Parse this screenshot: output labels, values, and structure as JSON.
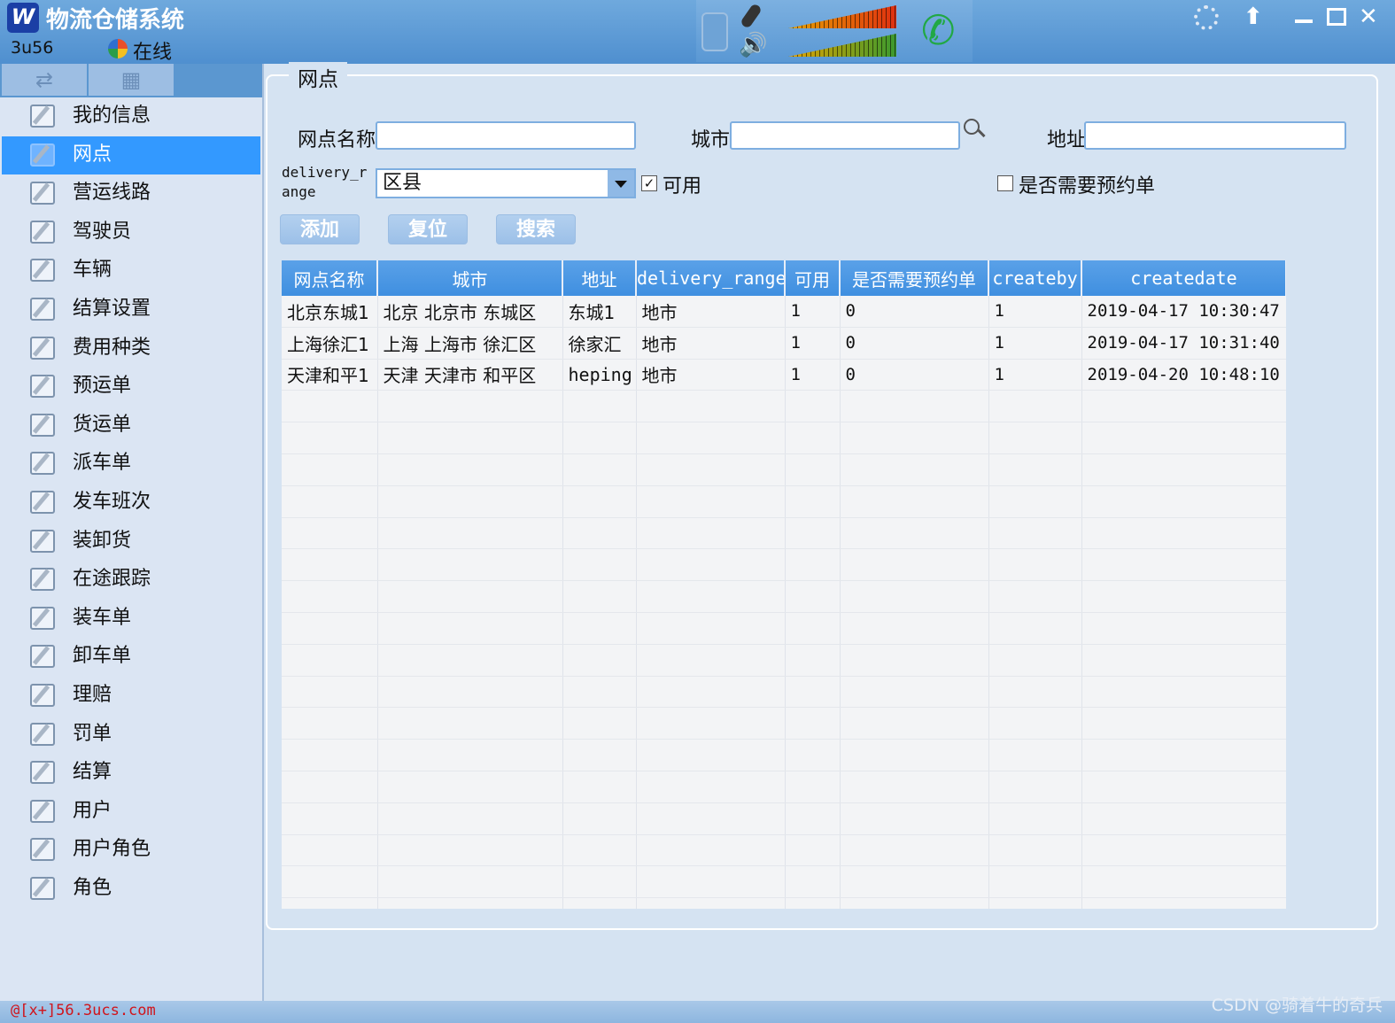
{
  "app": {
    "title": "物流仓储系统",
    "logo_text": "W",
    "user_id": "3u56",
    "status": "在线"
  },
  "window_controls": [
    "settings-icon",
    "upload-icon",
    "minimize-icon",
    "maximize-icon",
    "close-icon"
  ],
  "sidebar": {
    "tab_icons": [
      "switch-icon",
      "grid-icon"
    ],
    "items": [
      {
        "label": "我的信息"
      },
      {
        "label": "网点",
        "active": true
      },
      {
        "label": "营运线路"
      },
      {
        "label": "驾驶员"
      },
      {
        "label": "车辆"
      },
      {
        "label": "结算设置"
      },
      {
        "label": "费用种类"
      },
      {
        "label": "预运单"
      },
      {
        "label": "货运单"
      },
      {
        "label": "派车单"
      },
      {
        "label": "发车班次"
      },
      {
        "label": "装卸货"
      },
      {
        "label": "在途跟踪"
      },
      {
        "label": "装车单"
      },
      {
        "label": "卸车单"
      },
      {
        "label": "理赔"
      },
      {
        "label": "罚单"
      },
      {
        "label": "结算"
      },
      {
        "label": "用户"
      },
      {
        "label": "用户角色"
      },
      {
        "label": "角色"
      }
    ]
  },
  "panel": {
    "title": "网点",
    "filters": {
      "name_label": "网点名称",
      "name_value": "",
      "city_label": "城市",
      "city_value": "",
      "address_label": "地址",
      "address_value": "",
      "range_label": "delivery_range",
      "range_value": "区县",
      "available_label": "可用",
      "available_checked": true,
      "appointment_label": "是否需要预约单",
      "appointment_checked": false
    },
    "buttons": {
      "add": "添加",
      "reset": "复位",
      "search": "搜索"
    }
  },
  "table": {
    "columns": [
      "网点名称",
      "城市",
      "地址",
      "delivery_range",
      "可用",
      "是否需要预约单",
      "createby",
      "createdate"
    ],
    "rows": [
      [
        "北京东城1",
        "北京 北京市 东城区",
        "东城1",
        "地市",
        "1",
        "0",
        "1",
        "2019-04-17 10:30:47"
      ],
      [
        "上海徐汇1",
        "上海 上海市 徐汇区",
        "徐家汇",
        "地市",
        "1",
        "0",
        "1",
        "2019-04-17 10:31:40"
      ],
      [
        "天津和平1",
        "天津 天津市 和平区",
        "heping",
        "地市",
        "1",
        "0",
        "1",
        "2019-04-20 10:48:10"
      ]
    ],
    "empty_rows": 17
  },
  "statusbar": {
    "link": "@[x+]56.3ucs.com",
    "watermark": "CSDN @骑着牛的奇兵"
  }
}
